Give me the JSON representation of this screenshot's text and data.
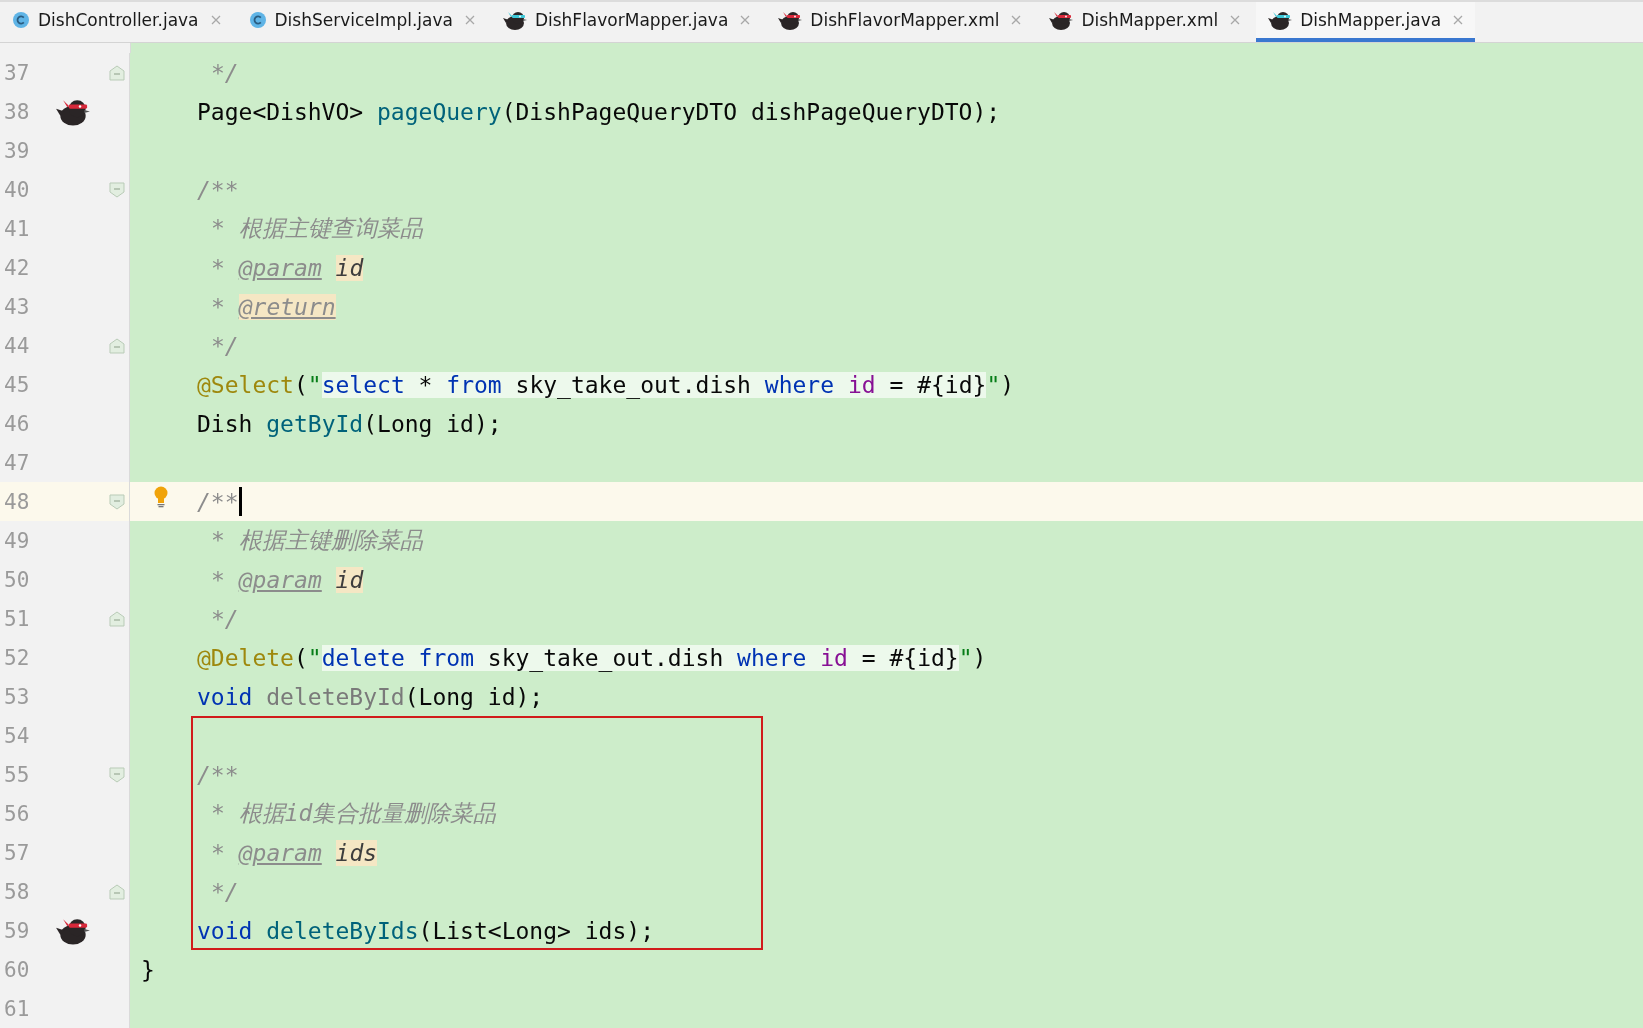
{
  "tabs": [
    {
      "label": "DishController.java",
      "kind": "class",
      "selected": false
    },
    {
      "label": "DishServiceImpl.java",
      "kind": "class",
      "selected": false
    },
    {
      "label": "DishFlavorMapper.java",
      "kind": "mapper-java",
      "selected": false
    },
    {
      "label": "DishFlavorMapper.xml",
      "kind": "mapper-xml",
      "selected": false
    },
    {
      "label": "DishMapper.xml",
      "kind": "mapper-xml",
      "selected": false
    },
    {
      "label": "DishMapper.java",
      "kind": "mapper-java",
      "selected": true
    }
  ],
  "editor": {
    "lines": [
      {
        "number": "37",
        "kind": "doc",
        "gutter": [
          {
            "kind": "fold-end"
          }
        ],
        "tokens": [
          {
            "kind": "comment",
            "text": "*/"
          }
        ]
      },
      {
        "number": "38",
        "kind": "member",
        "gutter": [
          {
            "kind": "mapper"
          }
        ],
        "tokens": [
          {
            "kind": "plain",
            "text": "Page<DishVO> "
          },
          {
            "kind": "method",
            "text": "pageQuery"
          },
          {
            "kind": "plain",
            "text": "(DishPageQueryDTO dishPageQueryDTO);"
          }
        ]
      },
      {
        "number": "39"
      },
      {
        "number": "40",
        "kind": "member",
        "gutter": [
          {
            "kind": "fold-start"
          }
        ],
        "tokens": [
          {
            "kind": "comment",
            "text": "/**"
          }
        ]
      },
      {
        "number": "41",
        "kind": "doc",
        "tokens": [
          {
            "kind": "comment",
            "text": "* 根据主键查询菜品"
          }
        ]
      },
      {
        "number": "42",
        "kind": "doc",
        "tokens": [
          {
            "kind": "comment",
            "text": "* "
          },
          {
            "kind": "tag",
            "text": "@param"
          },
          {
            "kind": "param",
            "text": "id"
          }
        ]
      },
      {
        "number": "43",
        "kind": "doc",
        "tokens": [
          {
            "kind": "comment",
            "text": "* "
          },
          {
            "kind": "tag-marked",
            "text": "@return"
          }
        ]
      },
      {
        "number": "44",
        "kind": "doc",
        "gutter": [
          {
            "kind": "fold-end"
          }
        ],
        "tokens": [
          {
            "kind": "comment",
            "text": "*/"
          }
        ]
      },
      {
        "number": "45",
        "kind": "member",
        "tokens": [
          {
            "kind": "annotation",
            "text": "@Select"
          },
          {
            "kind": "plain",
            "text": "("
          },
          {
            "kind": "string",
            "text": "\""
          },
          {
            "kind": "sql-keyword",
            "text": "select"
          },
          {
            "kind": "sql-text",
            "text": " * "
          },
          {
            "kind": "sql-keyword",
            "text": "from"
          },
          {
            "kind": "sql-text",
            "text": " sky_take_out.dish "
          },
          {
            "kind": "sql-keyword",
            "text": "where "
          },
          {
            "kind": "sql-column",
            "text": "id"
          },
          {
            "kind": "sql-text",
            "text": " = #{id}"
          },
          {
            "kind": "string",
            "text": "\""
          },
          {
            "kind": "plain",
            "text": ")"
          }
        ]
      },
      {
        "number": "46",
        "kind": "member",
        "tokens": [
          {
            "kind": "plain",
            "text": "Dish "
          },
          {
            "kind": "method",
            "text": "getById"
          },
          {
            "kind": "plain",
            "text": "(Long id);"
          }
        ]
      },
      {
        "number": "47"
      },
      {
        "number": "48",
        "kind": "member",
        "current": true,
        "caret": true,
        "gutter": [
          {
            "kind": "fold-start"
          },
          {
            "kind": "bulb"
          }
        ],
        "tokens": [
          {
            "kind": "comment",
            "text": "/**"
          }
        ]
      },
      {
        "number": "49",
        "kind": "doc",
        "tokens": [
          {
            "kind": "comment",
            "text": "* 根据主键删除菜品"
          }
        ]
      },
      {
        "number": "50",
        "kind": "doc",
        "tokens": [
          {
            "kind": "comment",
            "text": "* "
          },
          {
            "kind": "tag",
            "text": "@param"
          },
          {
            "kind": "param",
            "text": "id"
          }
        ]
      },
      {
        "number": "51",
        "kind": "doc",
        "gutter": [
          {
            "kind": "fold-end"
          }
        ],
        "tokens": [
          {
            "kind": "comment",
            "text": "*/"
          }
        ]
      },
      {
        "number": "52",
        "kind": "member",
        "tokens": [
          {
            "kind": "annotation",
            "text": "@Delete"
          },
          {
            "kind": "plain",
            "text": "("
          },
          {
            "kind": "string",
            "text": "\""
          },
          {
            "kind": "sql-keyword",
            "text": "delete "
          },
          {
            "kind": "sql-keyword",
            "text": "from"
          },
          {
            "kind": "sql-text",
            "text": " sky_take_out.dish "
          },
          {
            "kind": "sql-keyword",
            "text": "where "
          },
          {
            "kind": "sql-column",
            "text": "id"
          },
          {
            "kind": "sql-text",
            "text": " = #{id}"
          },
          {
            "kind": "string",
            "text": "\""
          },
          {
            "kind": "plain",
            "text": ")"
          }
        ]
      },
      {
        "number": "53",
        "kind": "member",
        "tokens": [
          {
            "kind": "keyword",
            "text": "void "
          },
          {
            "kind": "unused",
            "text": "deleteById"
          },
          {
            "kind": "plain",
            "text": "(Long id);"
          }
        ]
      },
      {
        "number": "54",
        "boxed": true
      },
      {
        "number": "55",
        "kind": "member",
        "boxed": true,
        "gutter": [
          {
            "kind": "fold-start"
          }
        ],
        "tokens": [
          {
            "kind": "comment",
            "text": "/**"
          }
        ]
      },
      {
        "number": "56",
        "kind": "doc",
        "boxed": true,
        "tokens": [
          {
            "kind": "comment",
            "text": "* 根据id集合批量删除菜品"
          }
        ]
      },
      {
        "number": "57",
        "kind": "doc",
        "boxed": true,
        "tokens": [
          {
            "kind": "comment",
            "text": "* "
          },
          {
            "kind": "tag",
            "text": "@param"
          },
          {
            "kind": "param",
            "text": "ids"
          }
        ]
      },
      {
        "number": "58",
        "kind": "doc",
        "boxed": true,
        "gutter": [
          {
            "kind": "fold-end"
          }
        ],
        "tokens": [
          {
            "kind": "comment",
            "text": "*/"
          }
        ]
      },
      {
        "number": "59",
        "kind": "member",
        "boxed": true,
        "gutter": [
          {
            "kind": "mapper"
          }
        ],
        "tokens": [
          {
            "kind": "keyword",
            "text": "void "
          },
          {
            "kind": "method",
            "text": "deleteByIds"
          },
          {
            "kind": "plain",
            "text": "(List<Long> ids);"
          }
        ]
      },
      {
        "number": "60",
        "kind": "top",
        "tokens": [
          {
            "kind": "plain",
            "text": "}"
          }
        ]
      },
      {
        "number": "61"
      }
    ]
  }
}
